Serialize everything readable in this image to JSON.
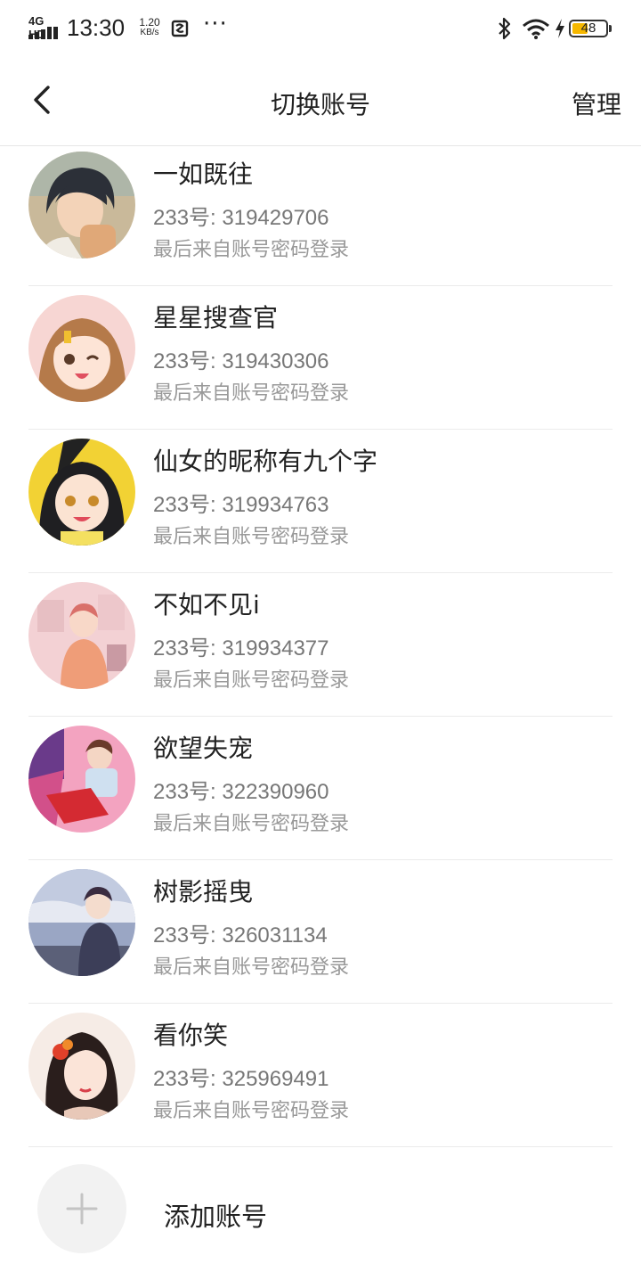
{
  "status_bar": {
    "network_label": "4G HD",
    "time": "13:30",
    "speed_value": "1.20",
    "speed_unit": "KB/s",
    "battery_level": "48",
    "battery_fraction": 0.48,
    "battery_fill_color": "#f6b800",
    "icons": [
      "signal-icon",
      "app-notification-icon",
      "more-icon",
      "bluetooth-icon",
      "wifi-icon",
      "charging-icon",
      "battery-icon"
    ]
  },
  "header": {
    "back_icon": "chevron-left-icon",
    "title": "切换账号",
    "manage_label": "管理"
  },
  "accounts": [
    {
      "name": "一如既往",
      "id": "233号: 319429706",
      "source": "最后来自账号密码登录"
    },
    {
      "name": "星星搜查官",
      "id": "233号: 319430306",
      "source": "最后来自账号密码登录"
    },
    {
      "name": "仙女的昵称有九个字",
      "id": "233号: 319934763",
      "source": "最后来自账号密码登录"
    },
    {
      "name": "不如不见i",
      "id": "233号: 319934377",
      "source": "最后来自账号密码登录"
    },
    {
      "name": "欲望失宠",
      "id": "233号: 322390960",
      "source": "最后来自账号密码登录"
    },
    {
      "name": "树影摇曳",
      "id": "233号: 326031134",
      "source": "最后来自账号密码登录"
    },
    {
      "name": "看你笑",
      "id": "233号: 325969491",
      "source": "最后来自账号密码登录"
    }
  ],
  "add_account": {
    "icon": "plus-icon",
    "label": "添加账号"
  }
}
